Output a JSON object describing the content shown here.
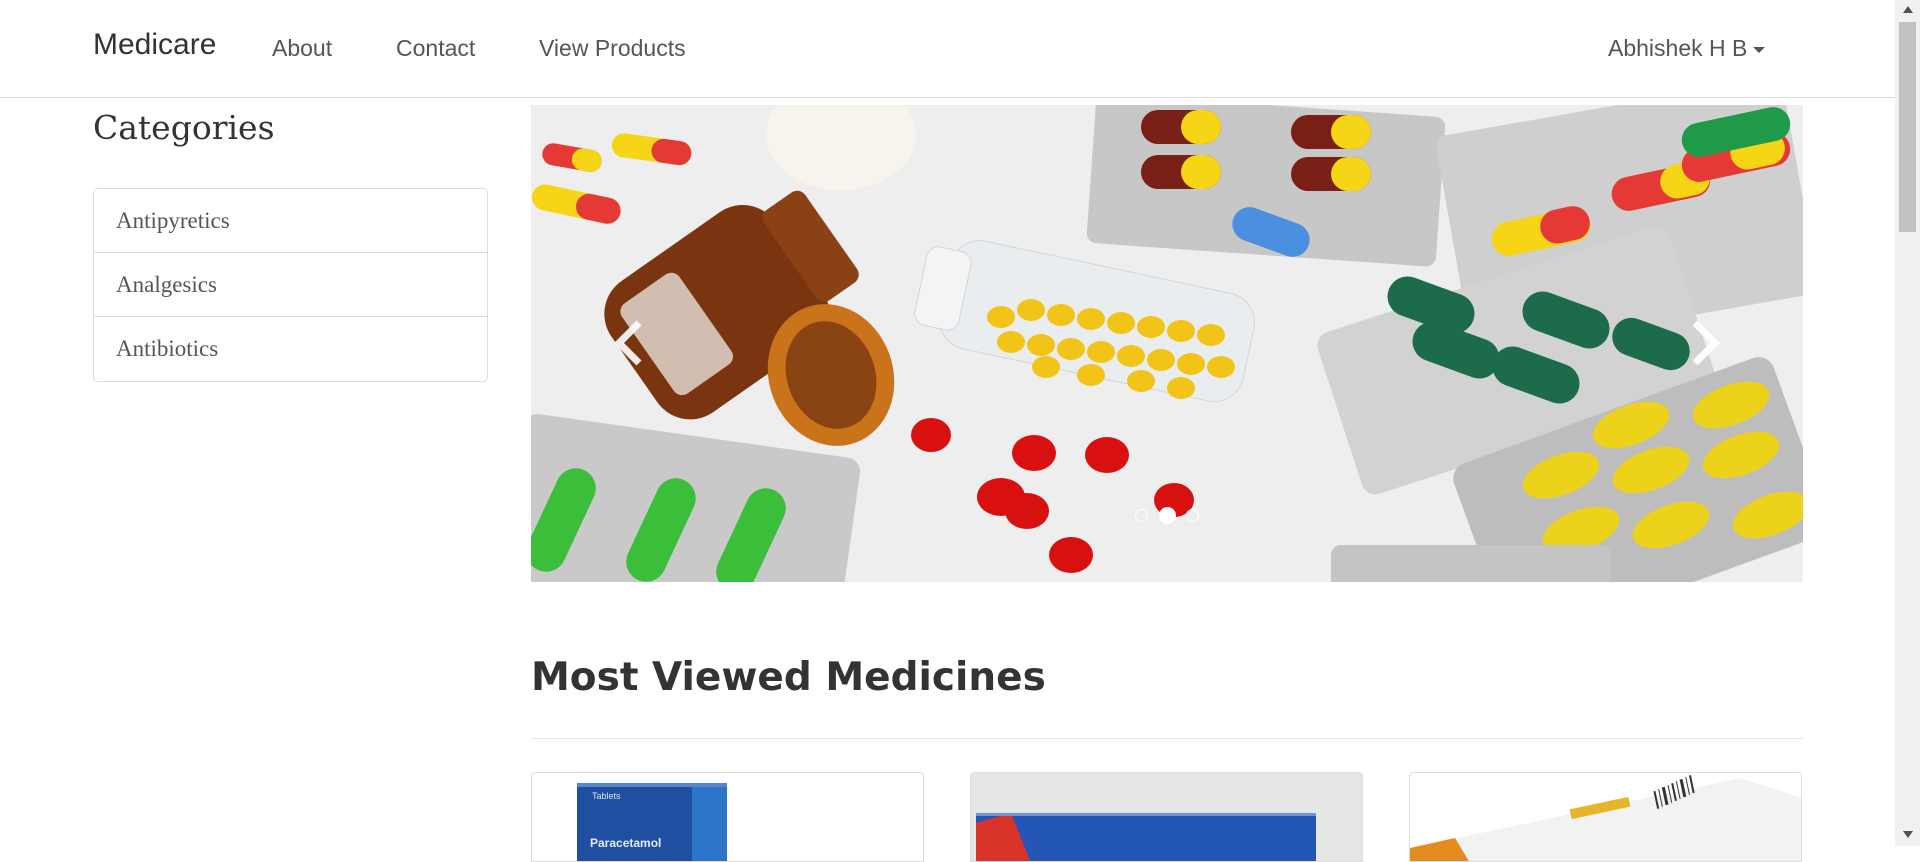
{
  "navbar": {
    "brand": "Medicare",
    "links": [
      "About",
      "Contact",
      "View Products"
    ],
    "user": "Abhishek H B"
  },
  "sidebar": {
    "title": "Categories",
    "items": [
      "Antipyretics",
      "Analgesics",
      "Antibiotics"
    ]
  },
  "carousel": {
    "slide_count": 3,
    "active_index": 1
  },
  "main": {
    "section_title": "Most Viewed Medicines"
  },
  "products": [
    {
      "image": "paracetamol-box",
      "box_text": "Paracetamol",
      "box_subtext": "Tablets"
    },
    {
      "image": "blue-medicine-box"
    },
    {
      "image": "white-orange-medicine-box"
    }
  ],
  "colors": {
    "navbar_border": "#dcdcdc",
    "text": "#333333",
    "link": "#555555"
  }
}
